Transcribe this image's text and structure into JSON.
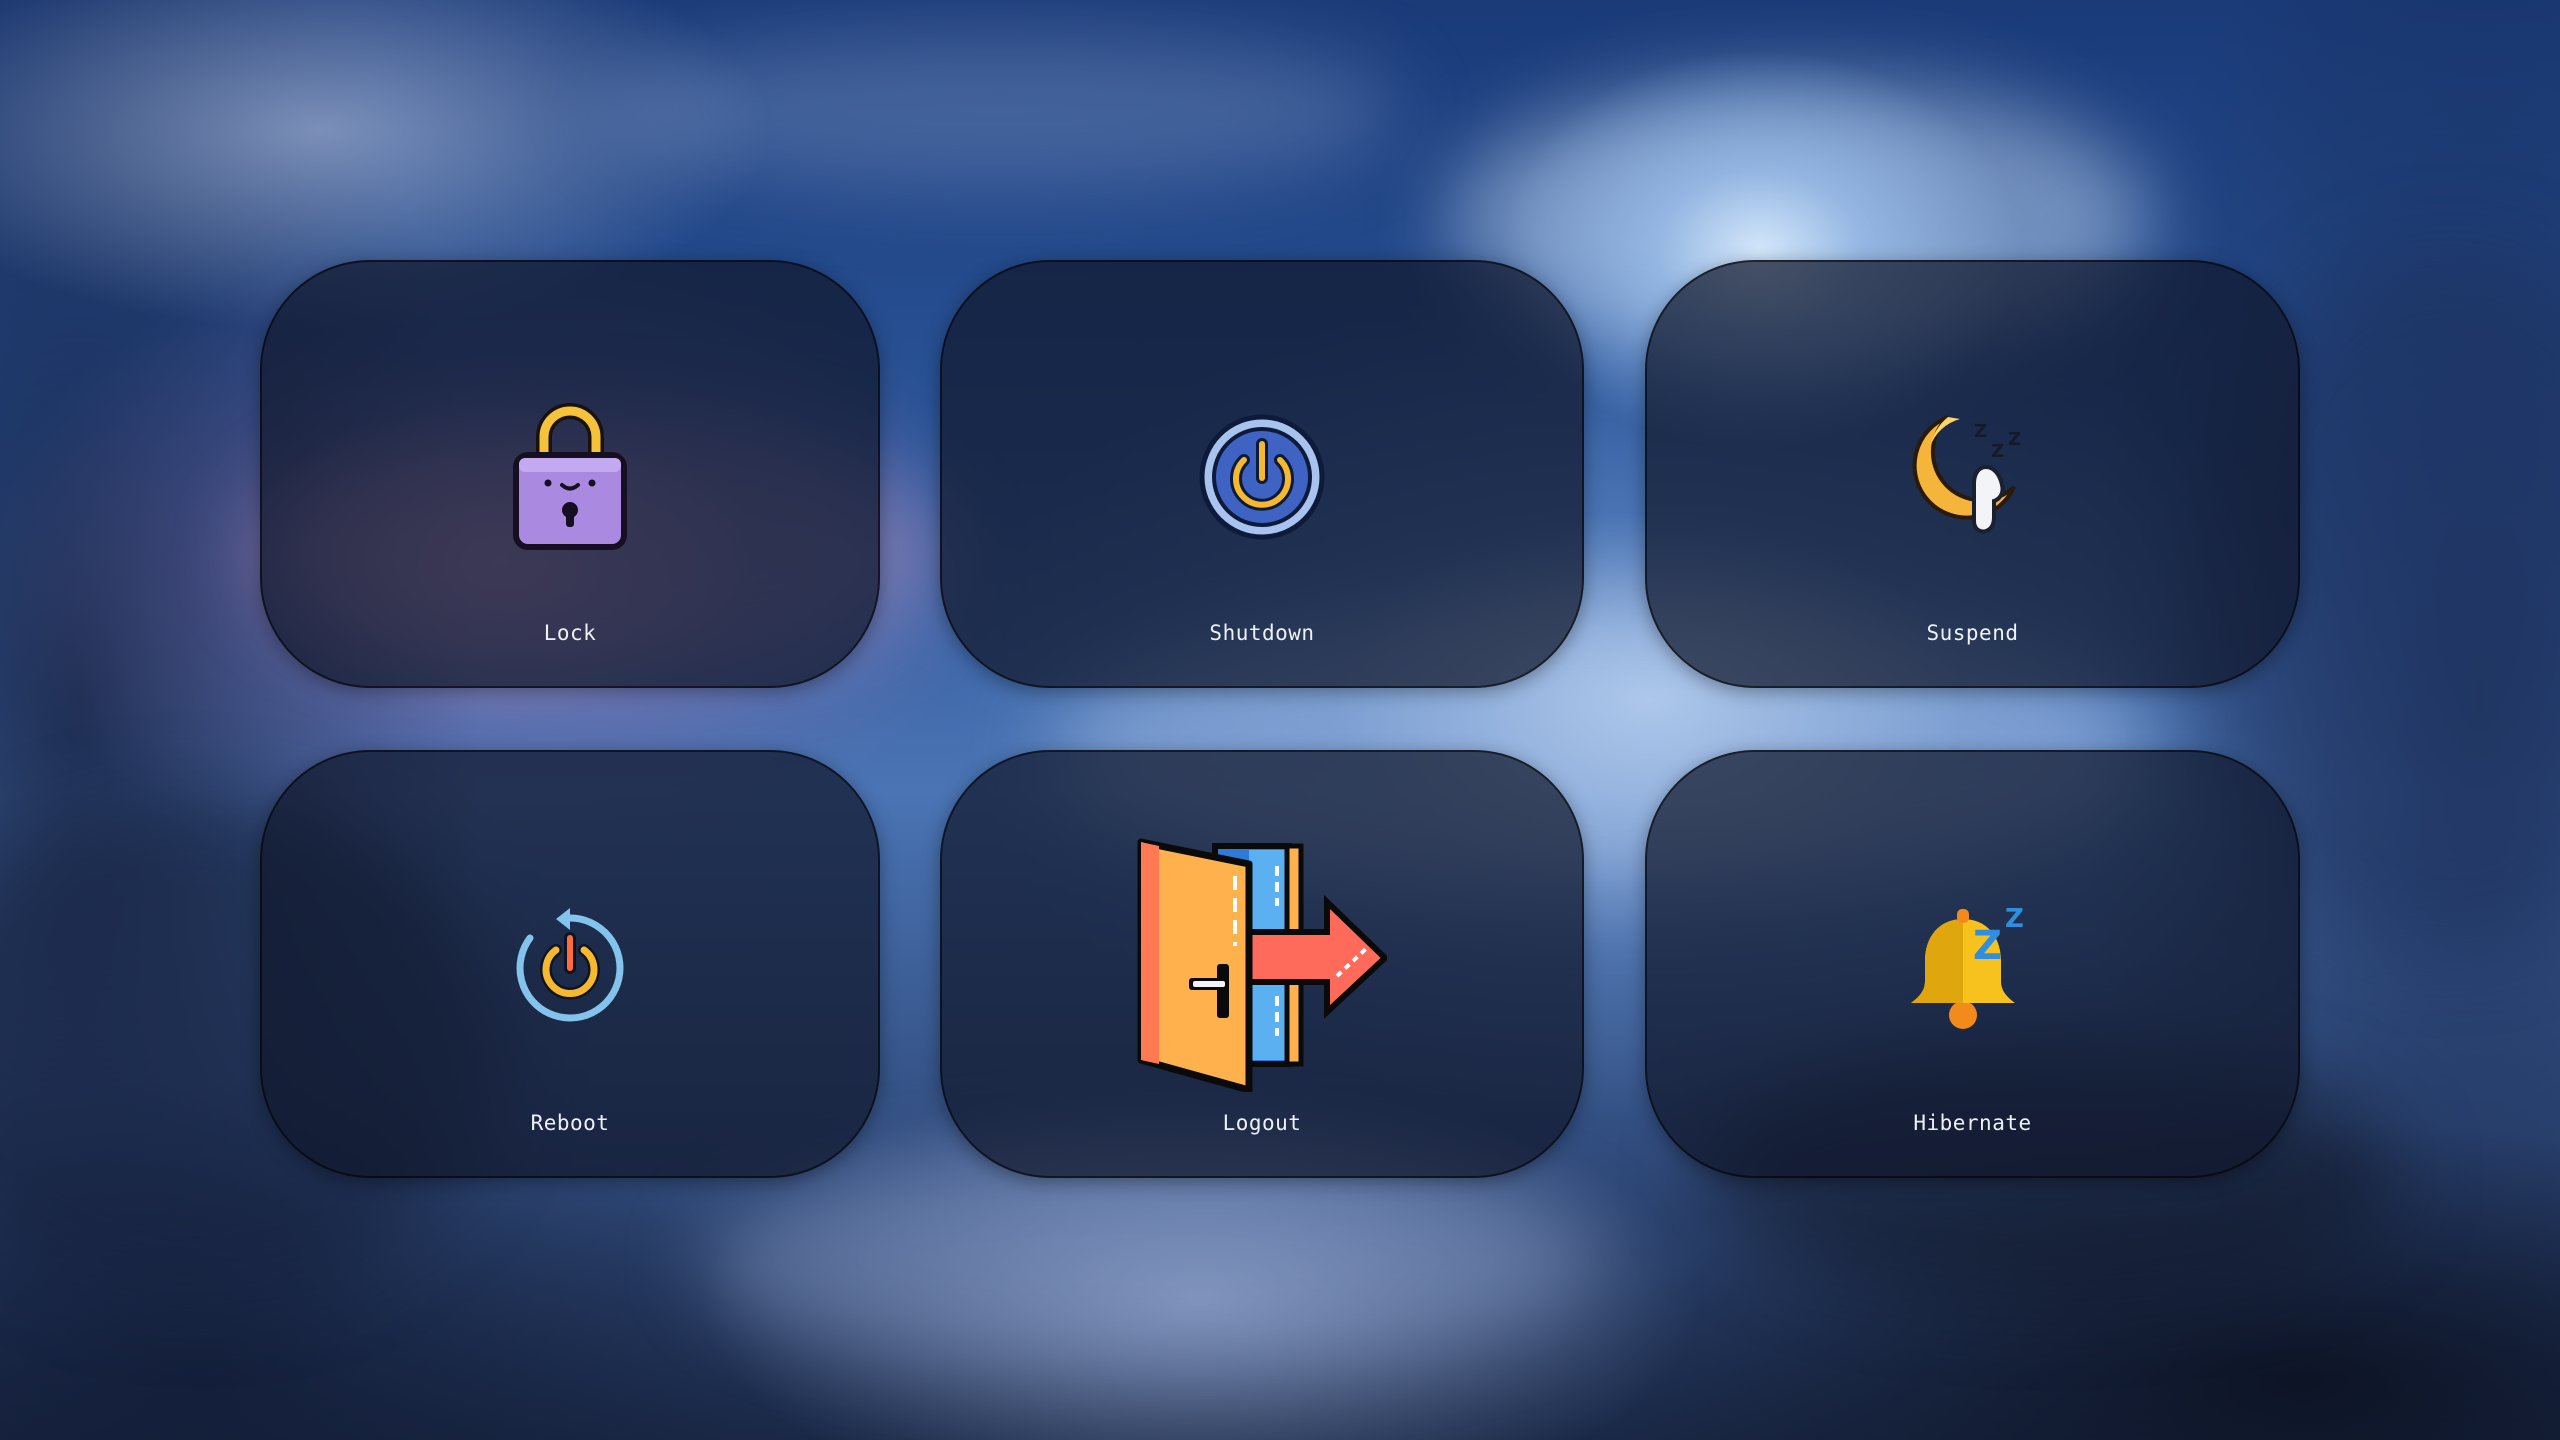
{
  "power_menu": {
    "items": [
      {
        "id": "lock",
        "label": "Lock",
        "icon": "padlock-icon"
      },
      {
        "id": "shutdown",
        "label": "Shutdown",
        "icon": "power-icon"
      },
      {
        "id": "suspend",
        "label": "Suspend",
        "icon": "sleeping-moon-icon"
      },
      {
        "id": "reboot",
        "label": "Reboot",
        "icon": "restart-power-icon"
      },
      {
        "id": "logout",
        "label": "Logout",
        "icon": "door-exit-icon"
      },
      {
        "id": "hibernate",
        "label": "Hibernate",
        "icon": "sleeping-bell-icon"
      }
    ]
  },
  "colors": {
    "tile_background": "#10182c",
    "label_text": "#eef1f6",
    "accent_yellow": "#f5b82e",
    "accent_purple": "#a98ae0",
    "accent_blue": "#3f63c2",
    "accent_orange": "#ffb14e",
    "accent_red": "#ff6b5b"
  }
}
